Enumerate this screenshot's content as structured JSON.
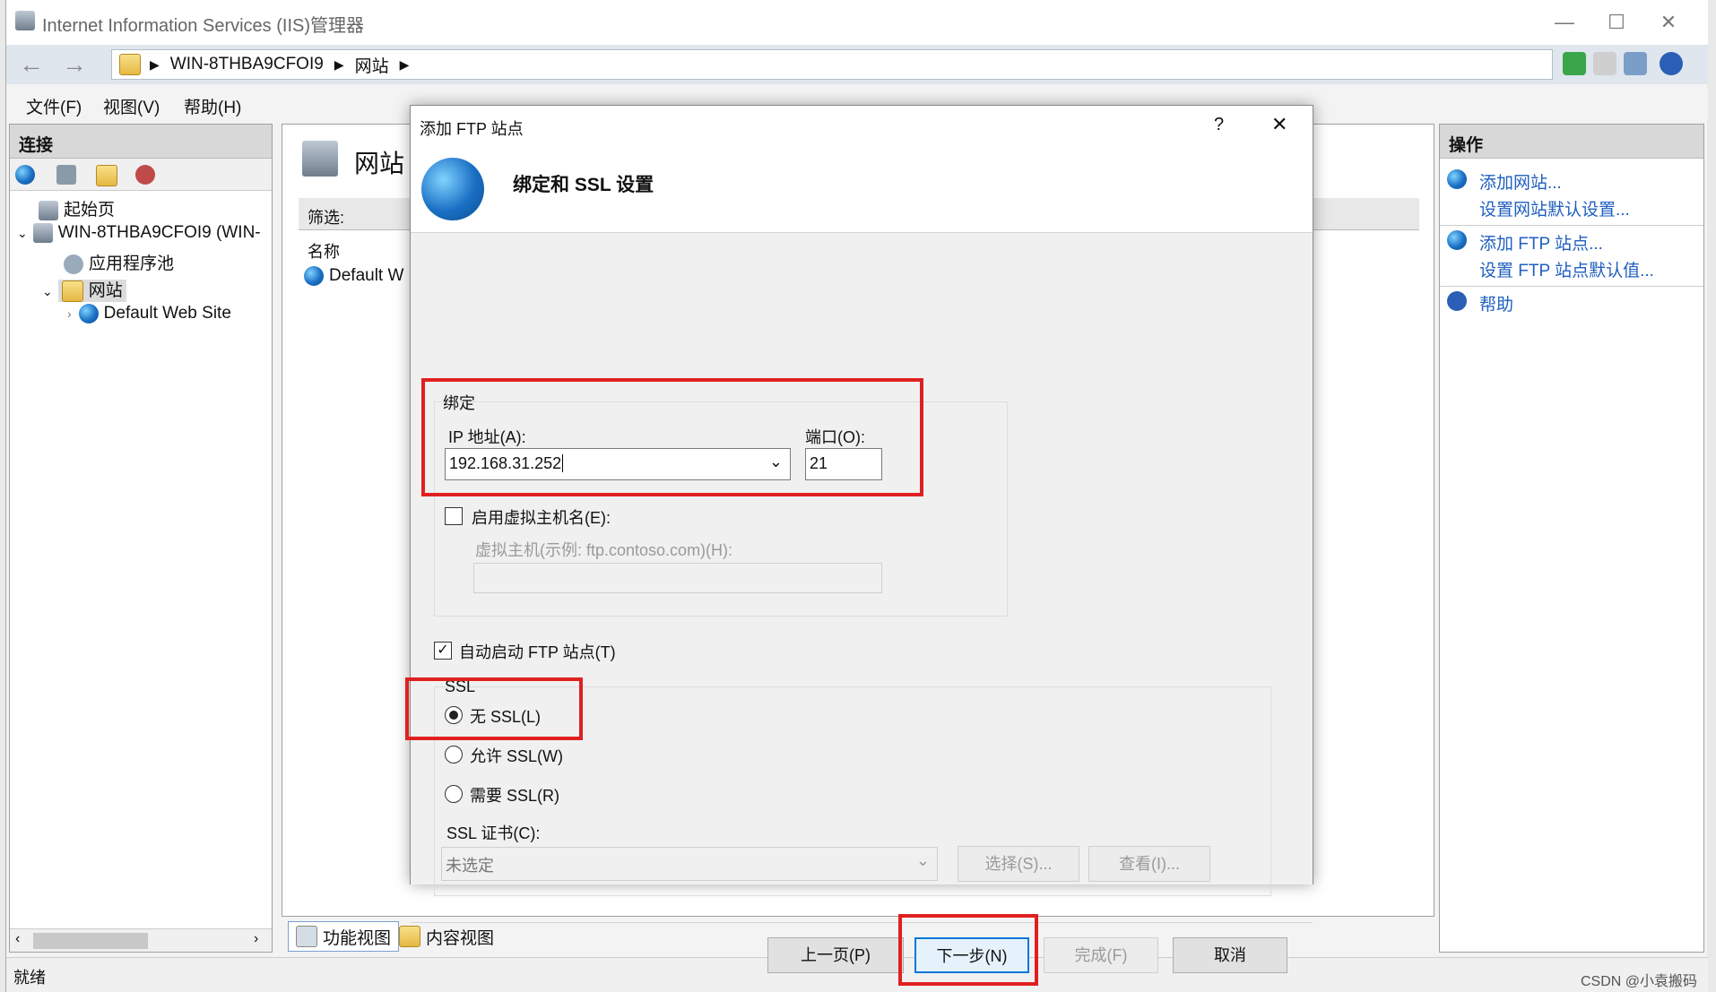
{
  "window": {
    "title": "Internet Information Services (IIS)管理器"
  },
  "address": {
    "segments": [
      "WIN-8THBA9CFOI9",
      "网站"
    ]
  },
  "menu": [
    "文件(F)",
    "视图(V)",
    "帮助(H)"
  ],
  "connections": {
    "header": "连接",
    "tree": [
      "起始页",
      "WIN-8THBA9CFOI9 (WIN-",
      "应用程序池",
      "网站",
      "Default Web Site"
    ]
  },
  "center": {
    "title": "网站",
    "filter_label": "筛选:",
    "column_name": "名称",
    "row_default": "Default W"
  },
  "bottom_tabs": [
    "功能视图",
    "内容视图"
  ],
  "actions": {
    "header": "操作",
    "items": [
      "添加网站...",
      "设置网站默认设置...",
      "添加 FTP 站点...",
      "设置 FTP 站点默认值...",
      "帮助"
    ]
  },
  "status": {
    "text": "就绪"
  },
  "watermark": "CSDN @小袁搬码",
  "dialog": {
    "title": "添加 FTP 站点",
    "help": "?",
    "close": "✕",
    "heading": "绑定和 SSL 设置",
    "binding": {
      "group_label": "绑定",
      "ip_label": "IP 地址(A):",
      "ip_value": "192.168.31.252",
      "port_label": "端口(O):",
      "port_value": "21",
      "vhost_check": "启用虚拟主机名(E):",
      "vhost_label": "虚拟主机(示例: ftp.contoso.com)(H):",
      "vhost_value": ""
    },
    "autostart": "自动启动 FTP 站点(T)",
    "ssl": {
      "group_label": "SSL",
      "none": "无 SSL(L)",
      "allow": "允许 SSL(W)",
      "require": "需要 SSL(R)",
      "cert_label": "SSL 证书(C):",
      "cert_value": "未选定",
      "select_btn": "选择(S)...",
      "view_btn": "查看(I)..."
    },
    "buttons": {
      "prev": "上一页(P)",
      "next": "下一步(N)",
      "finish": "完成(F)",
      "cancel": "取消"
    }
  }
}
